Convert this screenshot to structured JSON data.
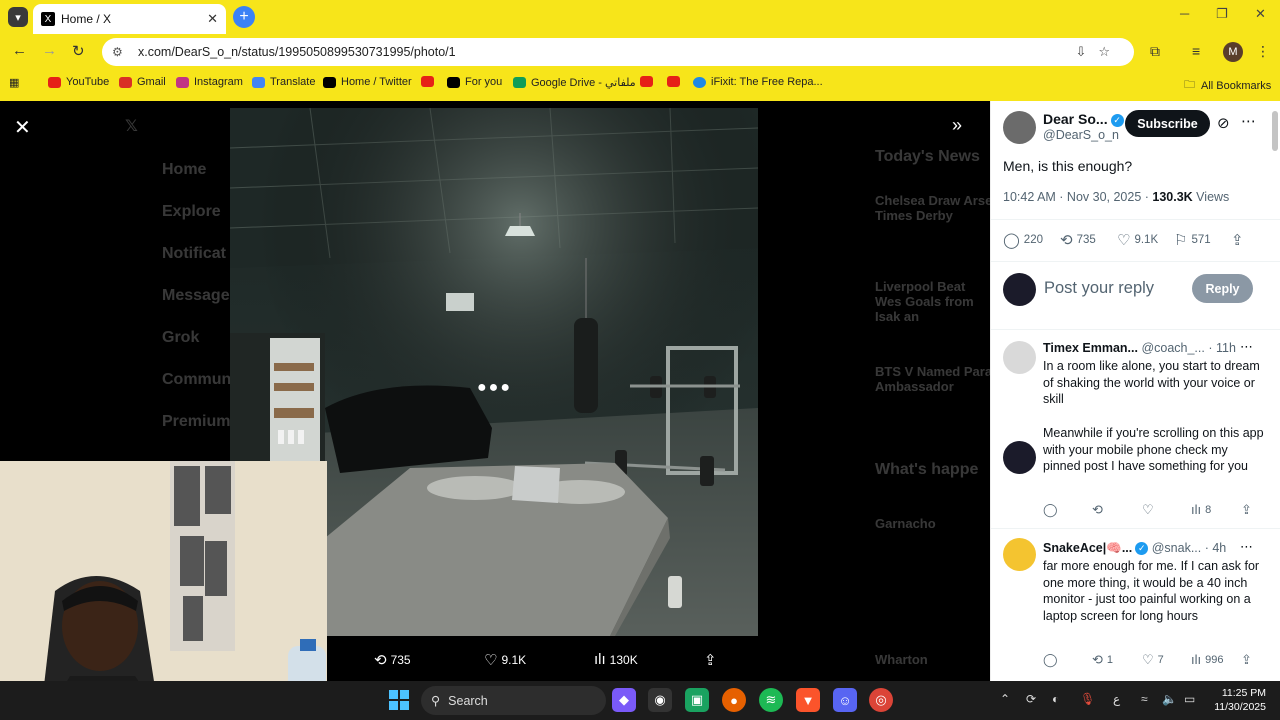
{
  "browser": {
    "tab_title": "Home / X",
    "tab_favicon": "X",
    "url": "x.com/DearS_o_n/status/1995050899530731995/photo/1",
    "profile_initial": "M",
    "bookmarks": [
      {
        "label": "YouTube",
        "color": "#e62117"
      },
      {
        "label": "Gmail",
        "color": "#d93025"
      },
      {
        "label": "Instagram",
        "color": "#c13584"
      },
      {
        "label": "Translate",
        "color": "#4285f4"
      },
      {
        "label": "Home / Twitter",
        "color": "#000000"
      },
      {
        "label": "",
        "color": "#e62117"
      },
      {
        "label": "For you",
        "color": "#000000"
      },
      {
        "label": "Google Drive - ملفاتي",
        "color": "#0f9d58"
      },
      {
        "label": "",
        "color": "#e62117"
      },
      {
        "label": "",
        "color": "#e62117"
      },
      {
        "label": "iFixit: The Free Repa...",
        "color": "#1e88e5"
      }
    ],
    "all_bookmarks": "All Bookmarks"
  },
  "background_x": {
    "nav": [
      "Home",
      "Explore",
      "Notificat",
      "Message",
      "Grok",
      "Commun",
      "Premium"
    ],
    "trends_title": "Today's News",
    "trends": [
      "Chelsea Draw Arse Times Derby",
      "Liverpool Beat Wes Goals from Isak an",
      "BTS V Named Para Ambassador"
    ],
    "whats_happening": "What's happe",
    "side_items": [
      "Garnacho",
      "Wharton"
    ]
  },
  "photo_actions": {
    "retweets": "735",
    "likes": "9.1K",
    "views": "130K"
  },
  "post": {
    "author_name": "Dear So...",
    "author_handle": "@DearS_o_n",
    "subscribe_label": "Subscribe",
    "text": "Men, is this enough?",
    "time": "10:42 AM · Nov 30, 2025 · ",
    "views_count": "130.3K",
    "views_label": " Views",
    "stats": {
      "replies": "220",
      "retweets": "735",
      "likes": "9.1K",
      "bookmarks": "571"
    },
    "reply_placeholder": "Post your reply",
    "reply_button": "Reply"
  },
  "replies": [
    {
      "name": "Timex Emman...",
      "handle": "@coach_... · 11h",
      "text": "In a room like alone, you start to dream of shaking the world with your voice or skill\n\nMeanwhile if you're scrolling on this app with your mobile phone check my pinned post I have something for you",
      "replies": "",
      "retweets": "",
      "likes": "",
      "views": "8"
    },
    {
      "name": "SnakeAce|🧠...",
      "handle": "@snak... · 4h",
      "text": "far more enough for me. If I can ask for one more thing, it would be a 40 inch monitor - just too painful working on a laptop screen for long hours",
      "replies": "",
      "retweets": "1",
      "likes": "7",
      "views": "996"
    }
  ],
  "taskbar": {
    "search_label": "Search",
    "time": "11:25 PM",
    "date": "11/30/2025",
    "lang": "ع"
  }
}
